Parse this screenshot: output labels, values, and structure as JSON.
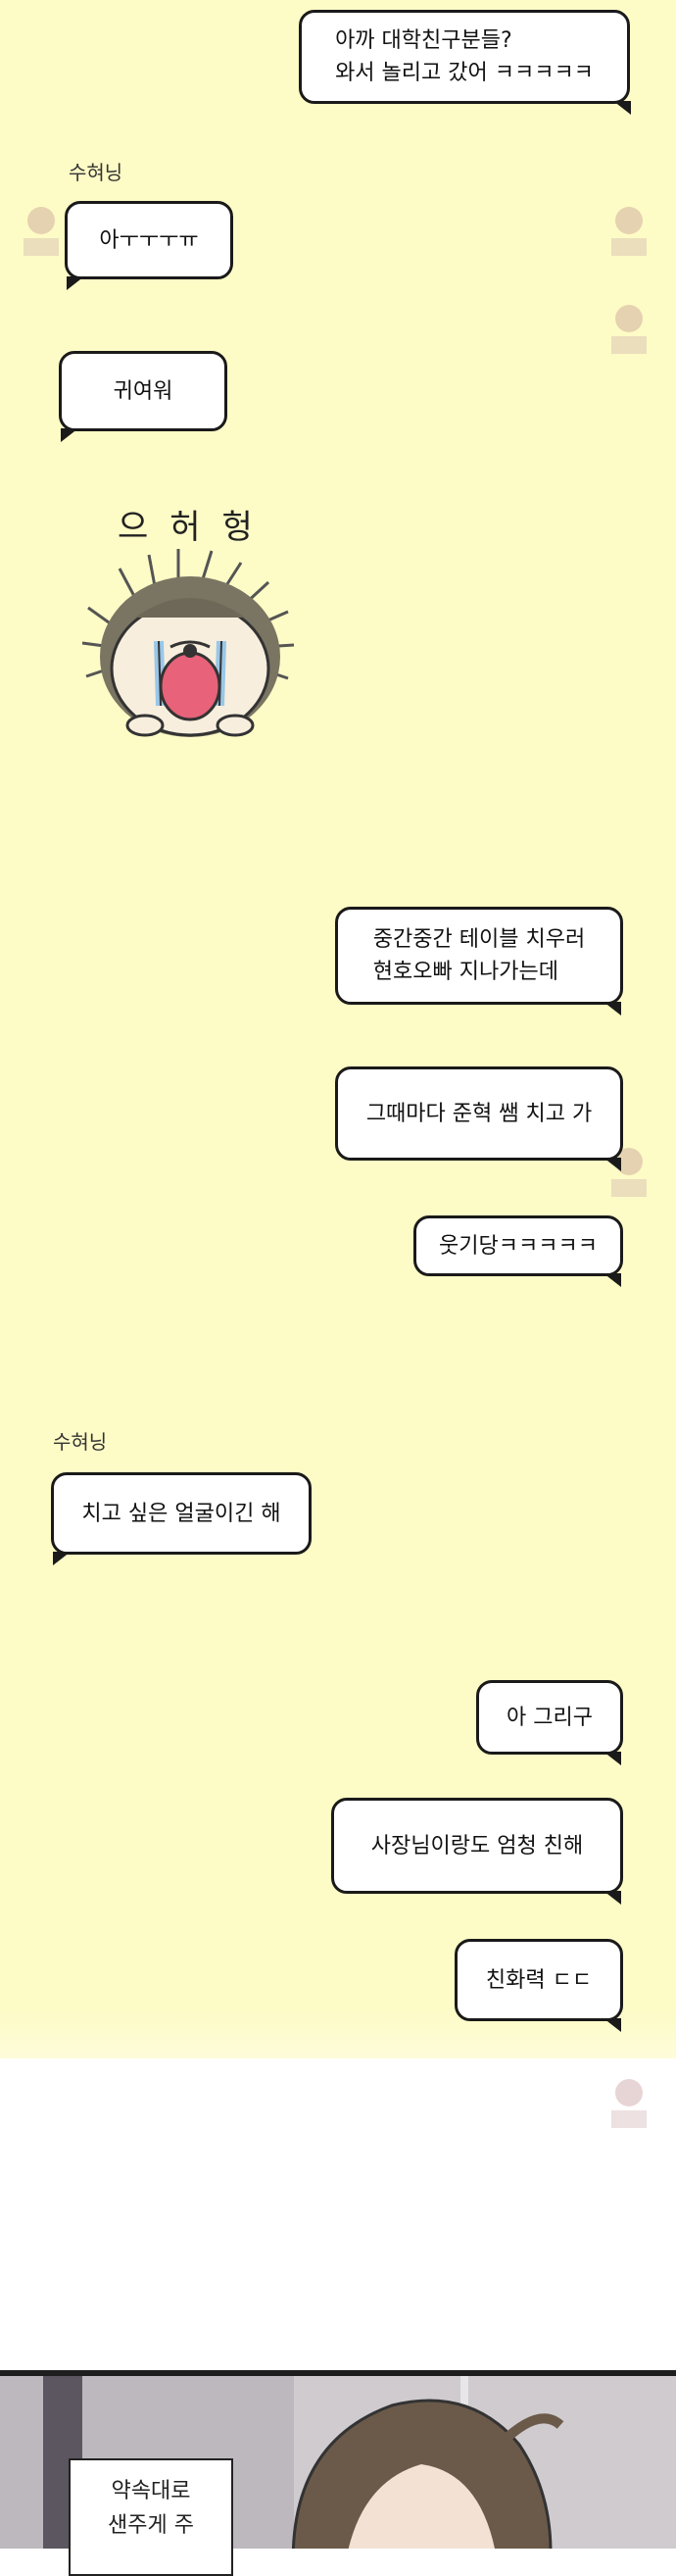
{
  "messages": [
    {
      "id": "m1",
      "text": "아까 대학친구분들?\n와서 놀리고 갔어 ㅋㅋㅋㅋㅋ"
    },
    {
      "id": "m2",
      "speaker": "수혀닝",
      "text": "아ㅜㅜㅜㅠ"
    },
    {
      "id": "m3",
      "text": "귀여워"
    },
    {
      "id": "m4",
      "text": "중간중간 테이블 치우러\n현호오빠 지나가는데"
    },
    {
      "id": "m5",
      "text": "그때마다 준혁 쌤 치고 가"
    },
    {
      "id": "m6",
      "text": "웃기당ㅋㅋㅋㅋㅋ"
    },
    {
      "id": "m7",
      "speaker": "수혀닝",
      "text": "치고 싶은 얼굴이긴 해"
    },
    {
      "id": "m8",
      "text": "아 그리구"
    },
    {
      "id": "m9",
      "text": "사장님이랑도 엄청 친해"
    },
    {
      "id": "m10",
      "text": "친화력 ㄷㄷ"
    }
  ],
  "sticker": {
    "sfx": "으허헝",
    "icon": "crying-hedgehog-sticker"
  },
  "narration": {
    "text": "약속대로\n샌주게 주"
  },
  "colors": {
    "background": "#fdfbc6",
    "bubble": "#ffffff",
    "outline": "#1a1a1a",
    "bottom_panel": "#cfcbcf"
  }
}
